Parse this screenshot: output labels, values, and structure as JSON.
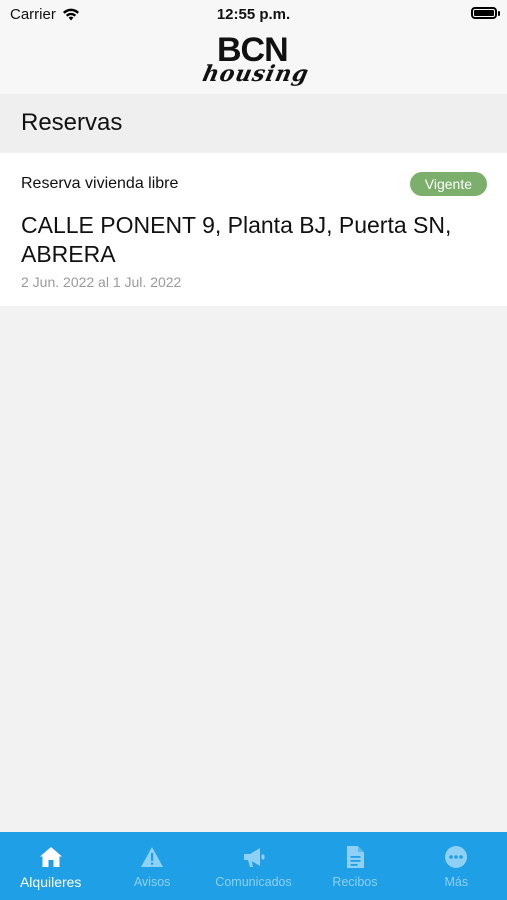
{
  "status_bar": {
    "carrier": "Carrier",
    "time": "12:55 p.m.",
    "battery_level": 1.0
  },
  "header": {
    "logo_top": "BCN",
    "logo_bottom": "housing"
  },
  "section": {
    "title": "Reservas"
  },
  "reservation": {
    "type": "Reserva vivienda libre",
    "status": "Vigente",
    "address": "CALLE PONENT 9, Planta BJ, Puerta SN, ABRERA",
    "dates": "2 Jun. 2022 al 1 Jul. 2022"
  },
  "tabs": [
    {
      "label": "Alquileres",
      "icon": "home-icon",
      "active": true
    },
    {
      "label": "Avisos",
      "icon": "warning-icon",
      "active": false
    },
    {
      "label": "Comunicados",
      "icon": "megaphone-icon",
      "active": false
    },
    {
      "label": "Recibos",
      "icon": "document-icon",
      "active": false
    },
    {
      "label": "Más",
      "icon": "more-icon",
      "active": false
    }
  ],
  "colors": {
    "tab_bar": "#1e9fe6",
    "badge": "#7caf6b",
    "active_tab": "#ffffff",
    "inactive_tab": "#8fd0f5"
  }
}
